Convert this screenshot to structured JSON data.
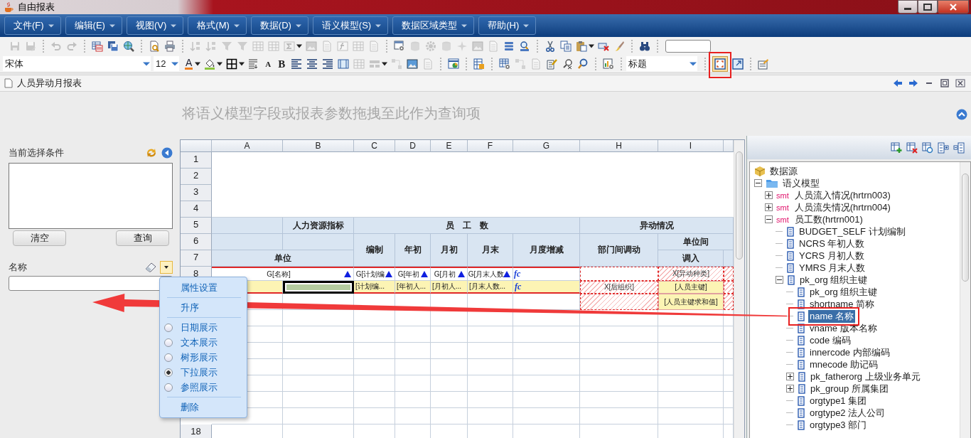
{
  "window": {
    "title": "自由报表"
  },
  "menu": [
    "文件(F)",
    "编辑(E)",
    "视图(V)",
    "格式(M)",
    "数据(D)",
    "语义模型(S)",
    "数据区域类型",
    "帮助(H)"
  ],
  "toolbar_1": [
    {
      "kind": "save",
      "disabled": true
    },
    {
      "kind": "saveas",
      "disabled": true
    },
    {
      "kind": "separator"
    },
    {
      "kind": "undo",
      "disabled": true
    },
    {
      "kind": "redo",
      "disabled": true
    },
    {
      "kind": "separator"
    },
    {
      "kind": "sheet",
      "disabled": false
    },
    {
      "kind": "saveall",
      "disabled": false
    },
    {
      "kind": "globe",
      "disabled": false
    },
    {
      "kind": "separator"
    },
    {
      "kind": "preview",
      "disabled": false
    },
    {
      "kind": "print",
      "disabled": false
    },
    {
      "kind": "separator"
    },
    {
      "kind": "sort",
      "disabled": true
    },
    {
      "kind": "sort",
      "disabled": true
    },
    {
      "kind": "filter",
      "disabled": true
    },
    {
      "kind": "filter",
      "disabled": true
    },
    {
      "kind": "table",
      "disabled": true
    },
    {
      "kind": "table",
      "disabled": true
    },
    {
      "kind": "sigma",
      "disabled": true
    },
    {
      "kind": "caret",
      "disabled": false
    },
    {
      "kind": "image",
      "disabled": true
    },
    {
      "kind": "doc",
      "disabled": true
    },
    {
      "kind": "func",
      "disabled": true
    },
    {
      "kind": "table",
      "disabled": true
    },
    {
      "kind": "doc",
      "disabled": true
    },
    {
      "kind": "separator"
    },
    {
      "kind": "wingear",
      "disabled": false
    },
    {
      "kind": "db",
      "disabled": true
    },
    {
      "kind": "gear",
      "disabled": true
    },
    {
      "kind": "db",
      "disabled": true
    },
    {
      "kind": "star",
      "disabled": true
    },
    {
      "kind": "image",
      "disabled": true
    },
    {
      "kind": "doc",
      "disabled": true
    },
    {
      "kind": "list",
      "disabled": false
    },
    {
      "kind": "searchgrid",
      "disabled": false
    },
    {
      "kind": "separator"
    },
    {
      "kind": "cut",
      "disabled": false
    },
    {
      "kind": "copy",
      "disabled": false
    },
    {
      "kind": "paste",
      "disabled": false
    },
    {
      "kind": "caret",
      "disabled": false
    },
    {
      "kind": "delete",
      "disabled": false
    },
    {
      "kind": "brush",
      "disabled": false
    },
    {
      "kind": "separator"
    },
    {
      "kind": "binoculars",
      "disabled": false
    },
    {
      "kind": "separator"
    },
    {
      "kind": "field"
    }
  ],
  "toolbar_2": [
    {
      "kind": "select",
      "value": "宋体"
    },
    {
      "kind": "select",
      "value": "12"
    },
    {
      "kind": "font-color",
      "label": "A",
      "disabled": false,
      "selected": false
    },
    {
      "kind": "caret",
      "disabled": false,
      "selected": false
    },
    {
      "kind": "fill",
      "disabled": false,
      "selected": false
    },
    {
      "kind": "caret",
      "disabled": false,
      "selected": false
    },
    {
      "kind": "border",
      "disabled": false,
      "selected": false
    },
    {
      "kind": "caret",
      "disabled": false,
      "selected": false
    },
    {
      "kind": "wrap",
      "disabled": false,
      "selected": false
    },
    {
      "kind": "grow-font",
      "label": "A",
      "disabled": false,
      "selected": false
    },
    {
      "kind": "bold",
      "label": "B",
      "disabled": false,
      "selected": false
    },
    {
      "kind": "alignleft",
      "disabled": false,
      "selected": false
    },
    {
      "kind": "aligncenter",
      "disabled": false,
      "selected": false
    },
    {
      "kind": "alignright",
      "disabled": false,
      "selected": false
    },
    {
      "kind": "column",
      "disabled": false,
      "selected": false
    },
    {
      "kind": "table",
      "disabled": true,
      "selected": false
    },
    {
      "kind": "merge",
      "disabled": true,
      "selected": false
    },
    {
      "kind": "caret",
      "disabled": false,
      "selected": false
    },
    {
      "kind": "flow",
      "disabled": true,
      "selected": false
    },
    {
      "kind": "image",
      "disabled": false,
      "selected": false
    },
    {
      "kind": "doc",
      "disabled": true,
      "selected": false
    },
    {
      "kind": "separator"
    },
    {
      "kind": "chart",
      "disabled": false,
      "selected": false
    },
    {
      "kind": "separator"
    },
    {
      "kind": "tables",
      "disabled": false,
      "selected": false
    },
    {
      "kind": "separator"
    },
    {
      "kind": "gridgear",
      "disabled": false,
      "selected": false
    },
    {
      "kind": "flow",
      "disabled": true,
      "selected": false
    },
    {
      "kind": "doc",
      "disabled": true,
      "selected": false
    },
    {
      "kind": "docedit",
      "disabled": false,
      "selected": false
    },
    {
      "kind": "searchx",
      "disabled": false,
      "selected": false
    },
    {
      "kind": "search",
      "disabled": false,
      "selected": false
    },
    {
      "kind": "separator"
    },
    {
      "kind": "chartgear",
      "disabled": false,
      "selected": false
    },
    {
      "kind": "separator"
    },
    {
      "kind": "select",
      "value": "标题"
    },
    {
      "kind": "separator"
    },
    {
      "kind": "fit",
      "disabled": false,
      "selected": true
    },
    {
      "kind": "expand",
      "disabled": false,
      "selected": false
    },
    {
      "kind": "separator"
    },
    {
      "kind": "props",
      "disabled": false,
      "selected": false
    }
  ],
  "tab": {
    "title": "人员异动月报表"
  },
  "hint": "将语义模型字段或报表参数拖拽至此作为查询项",
  "conditions": {
    "label": "当前选择条件",
    "buttons": [
      "清空",
      "查询"
    ]
  },
  "filter_field": {
    "label": "名称"
  },
  "sheet": {
    "columns": [
      "A",
      "B",
      "C",
      "D",
      "E",
      "F",
      "G",
      "H",
      "I"
    ],
    "row_headers": [
      {
        "kind": "label",
        "label": "1"
      },
      {
        "kind": "label",
        "label": "2"
      },
      {
        "kind": "label",
        "label": "3"
      },
      {
        "kind": "label",
        "label": "4"
      },
      {
        "kind": "label",
        "label": "5"
      },
      {
        "kind": "label",
        "label": "6"
      },
      {
        "kind": "label",
        "label": "7"
      },
      {
        "kind": "label",
        "label": "8"
      },
      {
        "kind": "covered"
      },
      {
        "kind": "covered"
      },
      {
        "kind": "covered"
      },
      {
        "kind": "covered"
      },
      {
        "kind": "covered"
      },
      {
        "kind": "covered"
      },
      {
        "kind": "covered"
      },
      {
        "kind": "covered"
      },
      {
        "kind": "covered"
      },
      {
        "kind": "label",
        "label": "18"
      }
    ],
    "rows": [
      [
        {
          "kind": "blank"
        },
        {
          "kind": "left"
        },
        {
          "kind": "left"
        },
        {
          "kind": "left"
        },
        {
          "kind": "left"
        },
        {
          "kind": "left"
        },
        {
          "kind": "left"
        },
        {
          "kind": "left"
        },
        {
          "kind": "left"
        },
        {
          "kind": "left"
        }
      ],
      [
        {
          "kind": "up"
        },
        {
          "kind": "up"
        },
        {
          "kind": "up"
        },
        {
          "kind": "up"
        },
        {
          "kind": "up"
        },
        {
          "kind": "up"
        },
        {
          "kind": "up"
        },
        {
          "kind": "up"
        },
        {
          "kind": "up"
        },
        {
          "kind": "up"
        }
      ],
      [
        {
          "kind": "up"
        },
        {
          "kind": "up"
        },
        {
          "kind": "up"
        },
        {
          "kind": "up"
        },
        {
          "kind": "up"
        },
        {
          "kind": "up"
        },
        {
          "kind": "up"
        },
        {
          "kind": "up"
        },
        {
          "kind": "up"
        },
        {
          "kind": "up"
        }
      ],
      [
        {
          "kind": "up"
        },
        {
          "kind": "up"
        },
        {
          "kind": "up"
        },
        {
          "kind": "up"
        },
        {
          "kind": "up"
        },
        {
          "kind": "up"
        },
        {
          "kind": "up"
        },
        {
          "kind": "up"
        },
        {
          "kind": "up"
        },
        {
          "kind": "up"
        }
      ],
      [
        {
          "kind": "head"
        },
        {
          "kind": "head",
          "text": "人力资源指标"
        },
        {
          "kind": "head",
          "text": "员　工　数"
        },
        {
          "kind": "left"
        },
        {
          "kind": "left"
        },
        {
          "kind": "left"
        },
        {
          "kind": "left"
        },
        {
          "kind": "head",
          "text": "异动情况"
        },
        {
          "kind": "left"
        },
        {
          "kind": "left"
        }
      ],
      [
        {
          "kind": "head"
        },
        {
          "kind": "head"
        },
        {
          "kind": "head",
          "text": "编制"
        },
        {
          "kind": "head",
          "text": "年初"
        },
        {
          "kind": "head",
          "text": "月初"
        },
        {
          "kind": "head",
          "text": "月末"
        },
        {
          "kind": "head",
          "text": "月度增减"
        },
        {
          "kind": "head",
          "text": "部门间调动"
        },
        {
          "kind": "head",
          "text": "单位间"
        },
        {
          "kind": "left"
        }
      ],
      [
        {
          "kind": "head",
          "text": "单位"
        },
        {
          "kind": "left"
        },
        {
          "kind": "up"
        },
        {
          "kind": "up"
        },
        {
          "kind": "up"
        },
        {
          "kind": "up"
        },
        {
          "kind": "up"
        },
        {
          "kind": "up"
        },
        {
          "kind": "head",
          "text": "调入"
        },
        {
          "kind": "head"
        }
      ],
      [
        {
          "kind": "group",
          "text": "G[名称]",
          "sorted": true,
          "formula": false
        },
        {
          "kind": "left"
        },
        {
          "kind": "group",
          "text": "G[计划编",
          "sorted": true,
          "formula": false
        },
        {
          "kind": "group",
          "text": "G[年初",
          "sorted": true,
          "formula": false
        },
        {
          "kind": "group",
          "text": "G[月初",
          "sorted": true,
          "formula": false
        },
        {
          "kind": "group",
          "text": "G[月末人数",
          "sorted": true,
          "formula": false
        },
        {
          "kind": "group",
          "text": "fc",
          "sorted": false,
          "formula": true
        },
        {
          "kind": "empty"
        },
        {
          "kind": "hatch",
          "text": "X[异动种类]"
        },
        {
          "kind": "hatch"
        }
      ],
      [
        {
          "kind": "detail",
          "selected": false
        },
        {
          "kind": "detail",
          "selected": true
        },
        {
          "kind": "detail",
          "text": "[计划编...",
          "selected": false,
          "formula": false
        },
        {
          "kind": "detail",
          "text": "[年初人...",
          "selected": false,
          "formula": false
        },
        {
          "kind": "detail",
          "text": "[月初人...",
          "selected": false,
          "formula": false
        },
        {
          "kind": "detail",
          "text": "[月末人数...",
          "selected": false,
          "formula": false
        },
        {
          "kind": "detail",
          "text": "fc",
          "selected": false,
          "formula": true
        },
        {
          "kind": "hatch",
          "text": "X[后组织]"
        },
        {
          "kind": "measure",
          "text": "[人员主键]"
        },
        {
          "kind": "hatch"
        }
      ],
      [
        {
          "kind": "plain"
        },
        {
          "kind": "plain"
        },
        {
          "kind": "plain"
        },
        {
          "kind": "plain"
        },
        {
          "kind": "plain"
        },
        {
          "kind": "plain"
        },
        {
          "kind": "plain"
        },
        {
          "kind": "hatch"
        },
        {
          "kind": "measure",
          "text": "[人员主键求和值]"
        },
        {
          "kind": "hatch"
        }
      ]
    ]
  },
  "context_menu": [
    {
      "kind": "action",
      "label": "属性设置"
    },
    {
      "kind": "separator"
    },
    {
      "kind": "action",
      "label": "升序"
    },
    {
      "kind": "separator"
    },
    {
      "kind": "radio",
      "label": "日期展示",
      "selected": false
    },
    {
      "kind": "radio",
      "label": "文本展示",
      "selected": false
    },
    {
      "kind": "radio",
      "label": "树形展示",
      "selected": false
    },
    {
      "kind": "radio",
      "label": "下拉展示",
      "selected": true
    },
    {
      "kind": "radio",
      "label": "参照展示",
      "selected": false
    },
    {
      "kind": "separator"
    },
    {
      "kind": "action",
      "label": "删除"
    }
  ],
  "tree": [
    {
      "kind": "source",
      "label": "数据源",
      "selected": false,
      "children": [
        {
          "kind": "folder",
          "label": "语义模型",
          "selected": false,
          "expanded": true,
          "children": [
            {
              "kind": "smt",
              "tag": "smt",
              "label": "人员流入情况(hrtrn003)",
              "selected": false,
              "expanded": false
            },
            {
              "kind": "smt",
              "tag": "smt",
              "label": "人员流失情况(hrtrn004)",
              "selected": false,
              "expanded": false
            },
            {
              "kind": "smt",
              "tag": "smt",
              "label": "员工数(hrtrn001)",
              "selected": false,
              "expanded": true,
              "children": [
                {
                  "kind": "field",
                  "label": "BUDGET_SELF  计划编制",
                  "selected": false
                },
                {
                  "kind": "field",
                  "label": "NCRS  年初人数",
                  "selected": false
                },
                {
                  "kind": "field",
                  "label": "YCRS  月初人数",
                  "selected": false
                },
                {
                  "kind": "field",
                  "label": "YMRS  月末人数",
                  "selected": false
                },
                {
                  "kind": "field",
                  "label": "pk_org  组织主键",
                  "selected": false,
                  "expanded": true,
                  "children": [
                    {
                      "kind": "field",
                      "label": "pk_org  组织主键",
                      "selected": false
                    },
                    {
                      "kind": "field",
                      "label": "shortname  简称",
                      "selected": false
                    },
                    {
                      "kind": "field",
                      "label": "name  名称",
                      "selected": true
                    },
                    {
                      "kind": "field",
                      "label": "vname  版本名称",
                      "selected": false
                    },
                    {
                      "kind": "field",
                      "label": "code  编码",
                      "selected": false
                    },
                    {
                      "kind": "field",
                      "label": "innercode  内部编码",
                      "selected": false
                    },
                    {
                      "kind": "field",
                      "label": "mnecode  助记码",
                      "selected": false
                    },
                    {
                      "kind": "field",
                      "label": "pk_fatherorg  上级业务单元",
                      "selected": false,
                      "expanded": false
                    },
                    {
                      "kind": "field",
                      "label": "pk_group  所属集团",
                      "selected": false,
                      "expanded": false
                    },
                    {
                      "kind": "field",
                      "label": "orgtype1  集团",
                      "selected": false
                    },
                    {
                      "kind": "field",
                      "label": "orgtype2  法人公司",
                      "selected": false
                    },
                    {
                      "kind": "field",
                      "label": "orgtype3  部门",
                      "selected": false
                    }
                  ]
                }
              ]
            }
          ]
        }
      ]
    }
  ]
}
